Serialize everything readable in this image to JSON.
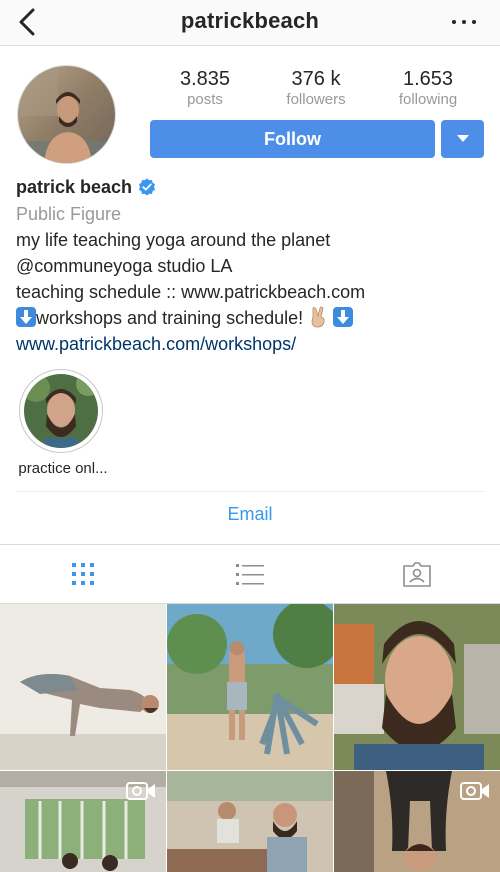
{
  "header": {
    "username": "patrickbeach"
  },
  "profile": {
    "stats": [
      {
        "value": "3.835",
        "label": "posts"
      },
      {
        "value": "376 k",
        "label": "followers"
      },
      {
        "value": "1.653",
        "label": "following"
      }
    ],
    "follow_label": "Follow",
    "name": "patrick beach",
    "verified": true,
    "category": "Public Figure",
    "bio_lines": [
      "my life teaching yoga around the planet",
      "@communeyoga studio LA",
      "teaching schedule :: www.patrickbeach.com"
    ],
    "bio_emoji_line_text": "workshops and training schedule!",
    "website": "www.patrickbeach.com/workshops/"
  },
  "highlights": [
    {
      "label": "practice onl..."
    }
  ],
  "contact": {
    "email_label": "Email"
  },
  "tabs": [
    {
      "icon": "grid-icon",
      "active": true
    },
    {
      "icon": "list-icon",
      "active": false
    },
    {
      "icon": "tagged-icon",
      "active": false
    }
  ],
  "posts": [
    {
      "type": "photo",
      "subject": "yoga-arm-balance"
    },
    {
      "type": "photo",
      "subject": "outdoor-partner-yoga"
    },
    {
      "type": "photo",
      "subject": "bearded-selfie"
    },
    {
      "type": "video",
      "subject": "studio-forest-mural"
    },
    {
      "type": "photo",
      "subject": "yoga-class-seated"
    },
    {
      "type": "video",
      "subject": "inverted-pose"
    }
  ],
  "colors": {
    "accent": "#4d8fe8",
    "link": "#003569",
    "email": "#3897f0",
    "muted": "#999999"
  }
}
